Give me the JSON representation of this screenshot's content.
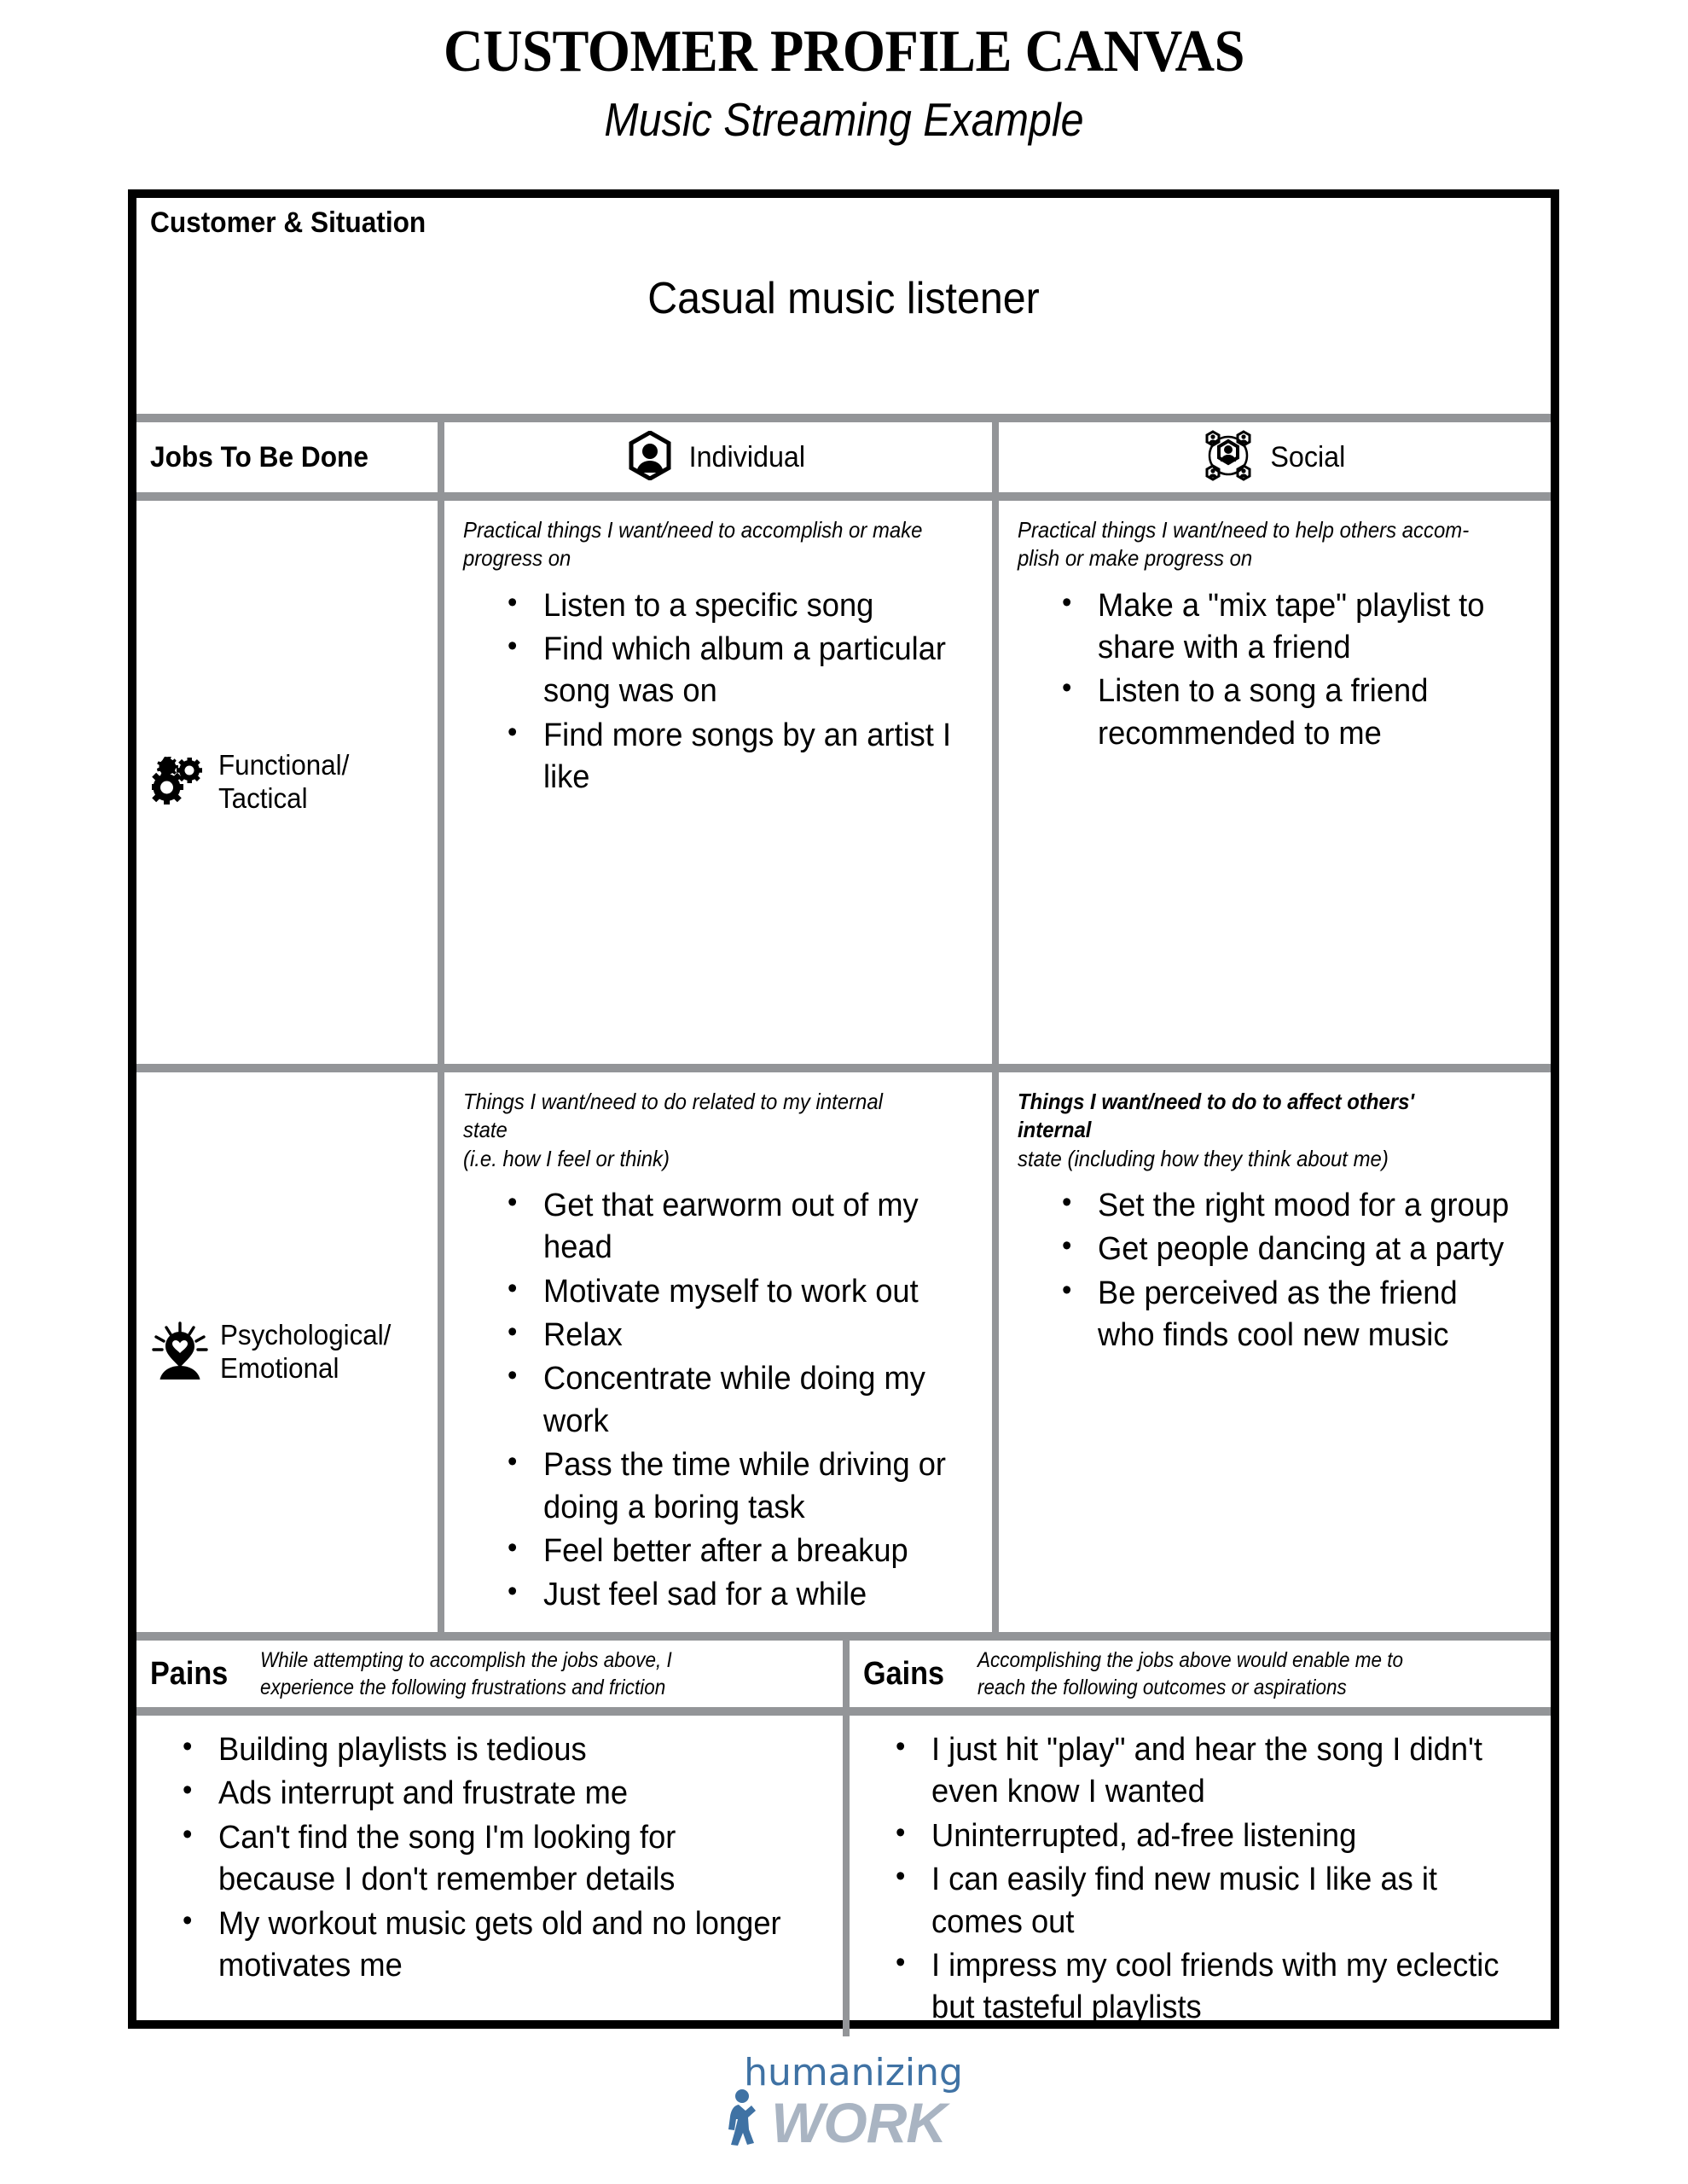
{
  "header": {
    "title": "CUSTOMER PROFILE CANVAS",
    "subtitle": "Music Streaming Example"
  },
  "customer_situation": {
    "label": "Customer & Situation",
    "value": "Casual music listener"
  },
  "jobs": {
    "section_label": "Jobs To Be Done",
    "columns": [
      {
        "label": "Individual",
        "icon": "individual-person-hexagon-icon"
      },
      {
        "label": "Social",
        "icon": "social-network-people-icon"
      }
    ],
    "rows": [
      {
        "label": "Functional/\nTactical",
        "label_line1": "Functional/",
        "label_line2": "Tactical",
        "icon": "gears-icon",
        "individual": {
          "hint": "Practical things I want/need to accomplish or make progress on",
          "items": [
            "Listen to a specific song",
            "Find which album a particular song was on",
            "Find more songs by an artist I like"
          ]
        },
        "social": {
          "hint": "Practical things I want/need to help others accom-plish or make progress on",
          "hint_line1": "Practical things I want/need to help others accom-",
          "hint_line2": "plish or make progress on",
          "items": [
            "Make a \"mix tape\" playlist to share with a friend",
            "Listen to a song a friend recommended to me"
          ]
        }
      },
      {
        "label": "Psychological/\nEmotional",
        "label_line1": "Psychological/",
        "label_line2": "Emotional",
        "icon": "psychological-emotional-head-heart-icon",
        "individual": {
          "hint": "Things I want/need to do related to my internal state (i.e. how I feel or think)",
          "hint_line1": "Things I want/need to do related to my internal state",
          "hint_line2": "(i.e. how I feel or think)",
          "items": [
            "Get that earworm out of my head",
            "Motivate myself to work out",
            "Relax",
            "Concentrate while doing my work",
            "Pass the time while driving or doing a boring task",
            "Feel better after a breakup",
            "Just feel sad for a while"
          ]
        },
        "social": {
          "hint": "Things I want/need to do to affect others' internal state (including how they think about me)",
          "hint_line1": "Things I want/need to do to affect others' internal",
          "hint_line2": "state (including how they think about me)",
          "items": [
            "Set the right mood for a group",
            "Get people dancing at a party",
            "Be perceived as the friend who finds cool new music"
          ]
        }
      }
    ]
  },
  "pains": {
    "title": "Pains",
    "hint_line1": "While attempting to accomplish the jobs above, I",
    "hint_line2": "experience the following frustrations and friction",
    "items": [
      "Building playlists is tedious",
      "Ads interrupt and frustrate me",
      "Can't find the song I'm looking for because I don't remember details",
      "My workout music gets old and no longer motivates me"
    ]
  },
  "gains": {
    "title": "Gains",
    "hint_line1": "Accomplishing the jobs above would enable me to",
    "hint_line2": "reach the following outcomes or aspirations",
    "items": [
      "I just hit \"play\" and hear the song I didn't even know I wanted",
      "Uninterrupted, ad-free listening",
      "I can easily find new music I like as it comes out",
      "I impress my cool friends with my eclectic but tasteful playlists"
    ]
  },
  "footer": {
    "logo_top": "humanizing",
    "logo_bottom": "WORK",
    "logo_color_top": "#3f72a4",
    "logo_color_bottom": "#a9b4c2"
  },
  "colors": {
    "frame": "#000000",
    "separator": "#939598",
    "background": "#ffffff"
  }
}
